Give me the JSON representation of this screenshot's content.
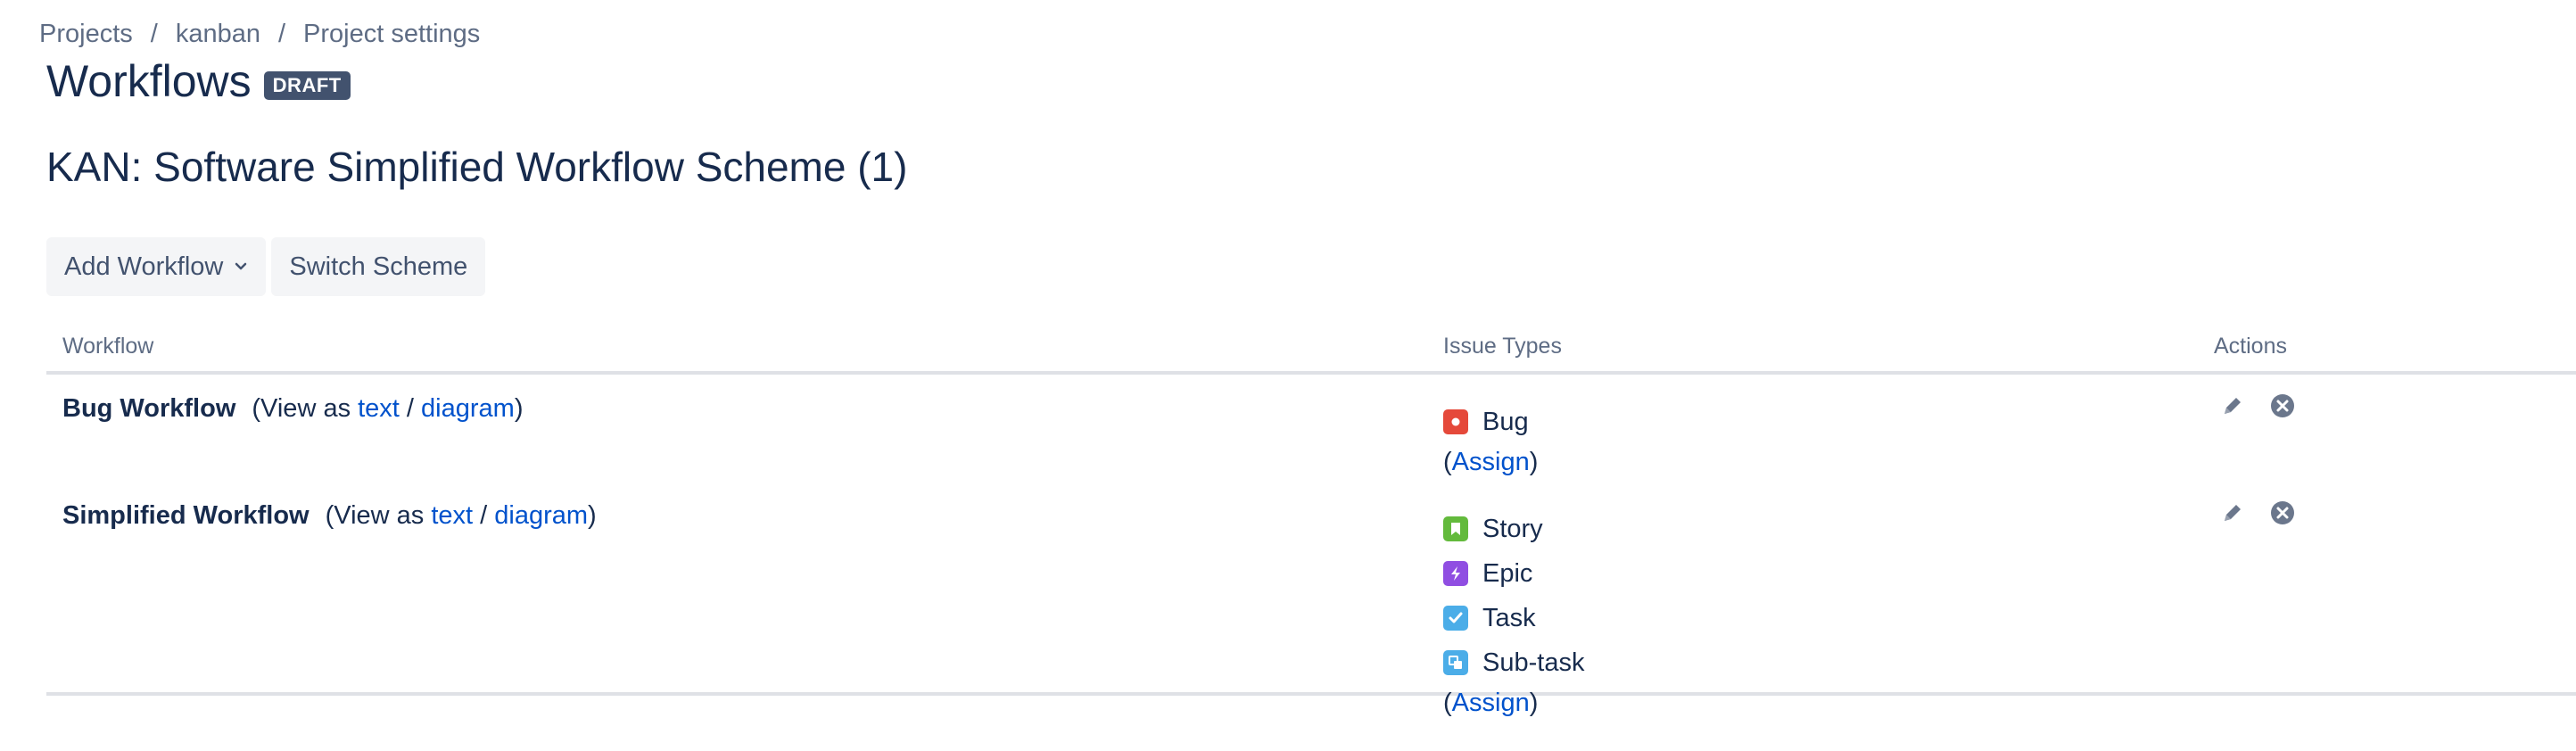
{
  "breadcrumb": {
    "items": [
      "Projects",
      "kanban",
      "Project settings"
    ],
    "separator": "/"
  },
  "page": {
    "title": "Workflows",
    "badge": "DRAFT",
    "scheme_name": "KAN: Software Simplified Workflow Scheme (1)"
  },
  "toolbar": {
    "add_workflow": "Add Workflow",
    "switch_scheme": "Switch Scheme"
  },
  "table": {
    "headers": {
      "workflow": "Workflow",
      "issue_types": "Issue Types",
      "actions": "Actions"
    },
    "rows": [
      {
        "name": "Bug Workflow",
        "view_prefix": "(View as ",
        "view_text": "text",
        "view_sep": " / ",
        "view_diagram": "diagram",
        "view_suffix": ")",
        "issue_types": [
          {
            "label": "Bug",
            "icon": "bug-icon",
            "color": "#e5493a"
          }
        ],
        "assign_open": "(",
        "assign": "Assign",
        "assign_close": ")"
      },
      {
        "name": "Simplified Workflow",
        "view_prefix": "(View as ",
        "view_text": "text",
        "view_sep": " / ",
        "view_diagram": "diagram",
        "view_suffix": ")",
        "issue_types": [
          {
            "label": "Story",
            "icon": "story-icon",
            "color": "#63ba3c"
          },
          {
            "label": "Epic",
            "icon": "epic-icon",
            "color": "#904ee2"
          },
          {
            "label": "Task",
            "icon": "task-icon",
            "color": "#4bade8"
          },
          {
            "label": "Sub-task",
            "icon": "subtask-icon",
            "color": "#4bade8"
          }
        ],
        "assign_open": "(",
        "assign": "Assign",
        "assign_close": ")"
      }
    ]
  },
  "icons": {
    "edit": "pencil-icon",
    "delete": "remove-circle-icon"
  },
  "colors": {
    "link": "#0052cc",
    "text": "#172b4d",
    "muted": "#5e6c84",
    "badge_bg": "#42526e"
  }
}
